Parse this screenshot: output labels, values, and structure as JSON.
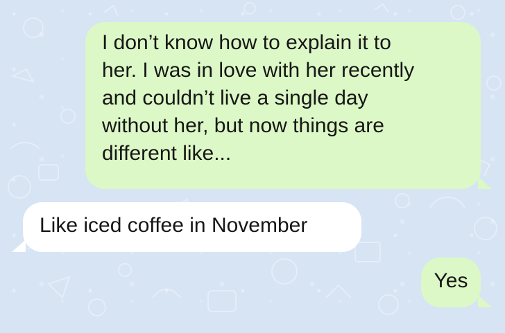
{
  "chat": {
    "messages": [
      {
        "direction": "outgoing",
        "lines": [
          "I don’t know how to explain it to",
          "her. I was in love with her recently",
          "and couldn’t live a single day",
          "without her, but now things are",
          "different like..."
        ]
      },
      {
        "direction": "incoming",
        "text": "Like iced coffee in November"
      },
      {
        "direction": "outgoing",
        "text": "Yes"
      }
    ]
  },
  "colors": {
    "background": "#d7e4f4",
    "outgoing_bubble": "#dcf8c6",
    "incoming_bubble": "#ffffff",
    "text": "#161616"
  }
}
